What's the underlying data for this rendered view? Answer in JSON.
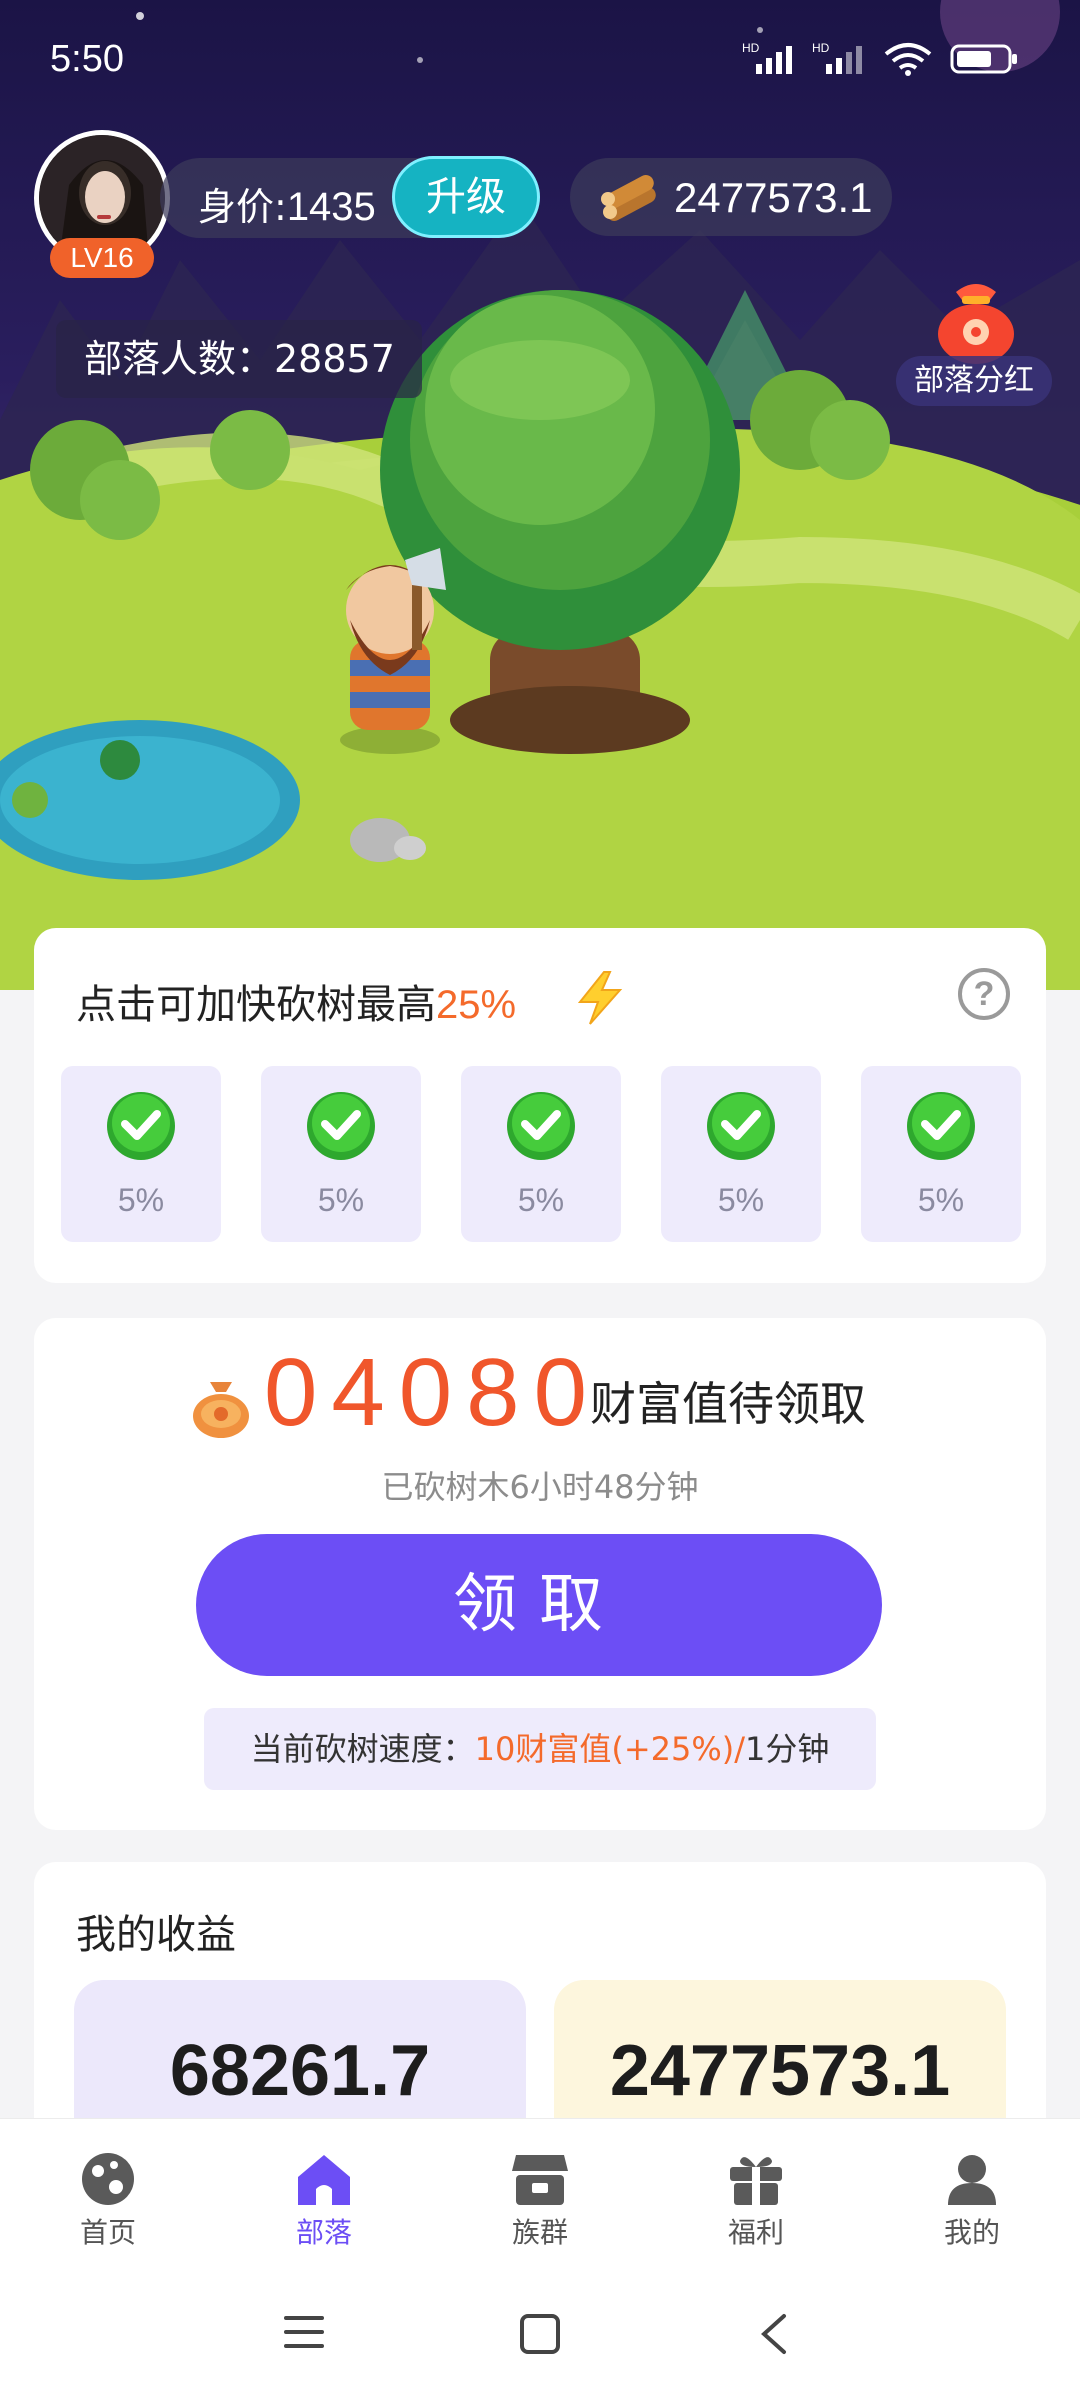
{
  "status_bar": {
    "time": "5:50",
    "network1": "HD",
    "network2": "HD",
    "wifi_level": "6"
  },
  "header": {
    "level": "LV16",
    "worth_label": "身价:",
    "worth_value": "1435",
    "upgrade_label": "升级",
    "wood_value": "2477573.1",
    "tribe_count_label": "部落人数：28857",
    "dividend_label": "部落分红"
  },
  "boost": {
    "title_prefix": "点击可加快砍树最高",
    "title_highlight": "25%",
    "help": "?",
    "slots": [
      {
        "pct": "5%",
        "checked": true
      },
      {
        "pct": "5%",
        "checked": true
      },
      {
        "pct": "5%",
        "checked": true
      },
      {
        "pct": "5%",
        "checked": true
      },
      {
        "pct": "5%",
        "checked": true
      }
    ]
  },
  "claim": {
    "pending_value": "04080",
    "pending_label": "财富值待领取",
    "elapsed": "已砍树木6小时48分钟",
    "button": "领取",
    "speed_prefix": "当前砍树速度：",
    "speed_highlight": "10财富值(+25%)/",
    "speed_suffix": "1分钟"
  },
  "earnings": {
    "title": "我的收益",
    "left_value": "68261.7",
    "right_value": "2477573.1"
  },
  "nav": [
    {
      "label": "首页",
      "icon": "home-planet-icon",
      "active": false
    },
    {
      "label": "部落",
      "icon": "house-icon",
      "active": true
    },
    {
      "label": "族群",
      "icon": "group-icon",
      "active": false
    },
    {
      "label": "福利",
      "icon": "gift-icon",
      "active": false
    },
    {
      "label": "我的",
      "icon": "user-icon",
      "active": false
    }
  ],
  "colors": {
    "accent": "#6c4ef5",
    "highlight": "#f46a2b",
    "check": "#3ac23a",
    "upgrade": "#15b3c2"
  }
}
